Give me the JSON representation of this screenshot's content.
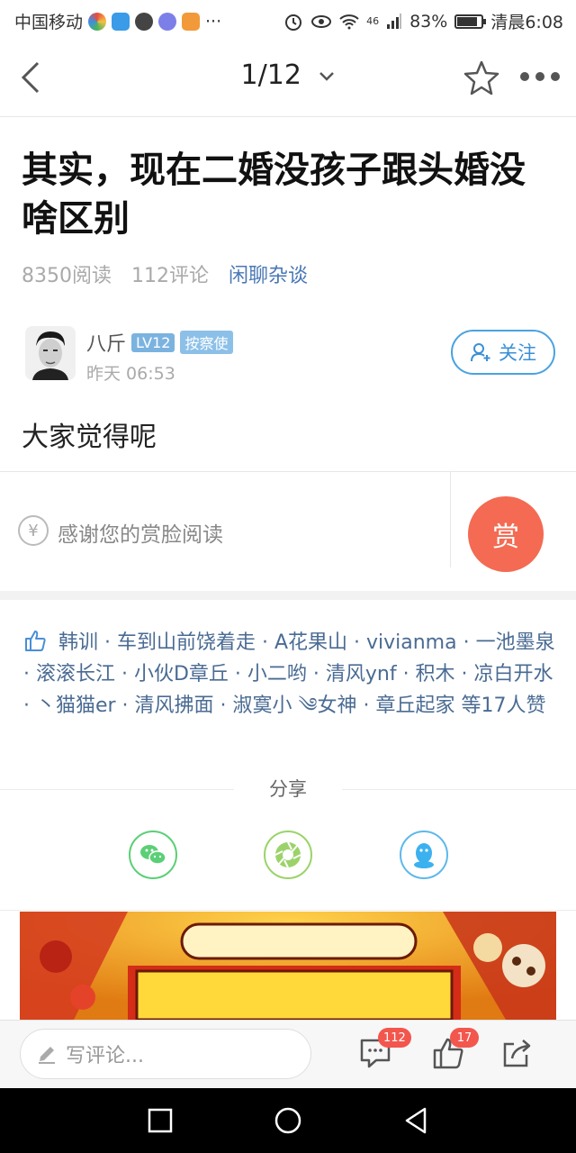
{
  "status": {
    "carrier": "中国移动",
    "network": "46",
    "battery": "83%",
    "time": "清晨6:08",
    "dots": "···"
  },
  "topbar": {
    "pager": "1/12"
  },
  "article": {
    "title": "其实，现在二婚没孩子跟头婚没啥区别",
    "reads": "8350阅读",
    "comments": "112评论",
    "category": "闲聊杂谈",
    "body": "大家觉得呢"
  },
  "author": {
    "name": "八斤",
    "level": "LV12",
    "role": "按察使",
    "time": "昨天 06:53",
    "follow_label": "关注"
  },
  "reward": {
    "yen": "¥",
    "text": "感谢您的赏脸阅读",
    "button": "赏"
  },
  "likes": {
    "text": "韩训 · 车到山前饶着走 · A花果山 · vivianma · 一池墨泉 · 滚滚长江 · 小伙D章丘 · 小二哟 · 清风ynf · 积木 · 凉白开水 · 丶猫猫er · 清风拂面 · 淑寞小 ༄女神 · 章丘起家 等17人赞"
  },
  "share": {
    "label": "分享"
  },
  "bottom": {
    "comment_placeholder": "写评论...",
    "comment_count": "112",
    "like_count": "17"
  },
  "colors": {
    "accent_blue": "#3a8fd6",
    "reward_red": "#f46a52",
    "badge_red": "#f3564d"
  }
}
